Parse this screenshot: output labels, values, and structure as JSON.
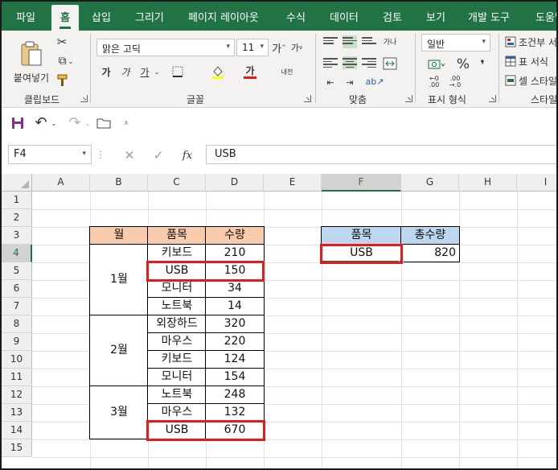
{
  "ribbon_tabs": [
    "파일",
    "홈",
    "삽입",
    "그리기",
    "페이지 레이아웃",
    "수식",
    "데이터",
    "검토",
    "보기",
    "개발 도구",
    "도움말"
  ],
  "clipboard": {
    "paste_label": "붙여넣기",
    "group_label": "클립보드"
  },
  "font": {
    "name": "맑은 고딕",
    "size": "11",
    "group_label": "글꼴",
    "bold": "가",
    "italic": "가",
    "underline": "가",
    "font_color_glyph": "가",
    "phonetic": "내천"
  },
  "alignment": {
    "group_label": "맞춤",
    "wrap_glyph": "가나"
  },
  "number": {
    "format": "일반",
    "group_label": "표시 형식",
    "percent": "%",
    "comma": "❜"
  },
  "styles": {
    "conditional": "조건부 서",
    "table_format": "표 서식",
    "cell_style": "셀 스타일",
    "group_label": "스타일"
  },
  "formula_bar": {
    "name_box": "F4",
    "fx": "fx",
    "value": "USB"
  },
  "columns": [
    "A",
    "B",
    "C",
    "D",
    "E",
    "F",
    "G",
    "H",
    "I"
  ],
  "rows": [
    "1",
    "2",
    "3",
    "4",
    "5",
    "6",
    "7",
    "8",
    "9",
    "10",
    "11",
    "12",
    "13",
    "14",
    "15"
  ],
  "table": {
    "headers": [
      "월",
      "품목",
      "수량"
    ],
    "months": [
      "1월",
      "2월",
      "3월"
    ],
    "items": [
      [
        "키보드",
        "210"
      ],
      [
        "USB",
        "150"
      ],
      [
        "모니터",
        "34"
      ],
      [
        "노트북",
        "14"
      ],
      [
        "외장하드",
        "320"
      ],
      [
        "마우스",
        "220"
      ],
      [
        "키보드",
        "124"
      ],
      [
        "모니터",
        "154"
      ],
      [
        "노트북",
        "248"
      ],
      [
        "마우스",
        "132"
      ],
      [
        "USB",
        "670"
      ]
    ]
  },
  "lookup": {
    "headers": [
      "품목",
      "총수량"
    ],
    "item": "USB",
    "total": "820"
  },
  "colors": {
    "ribbon_green": "#217346",
    "header_orange": "#f8cbad",
    "header_blue": "#bdd7ee",
    "highlight_red": "#e8191b"
  }
}
